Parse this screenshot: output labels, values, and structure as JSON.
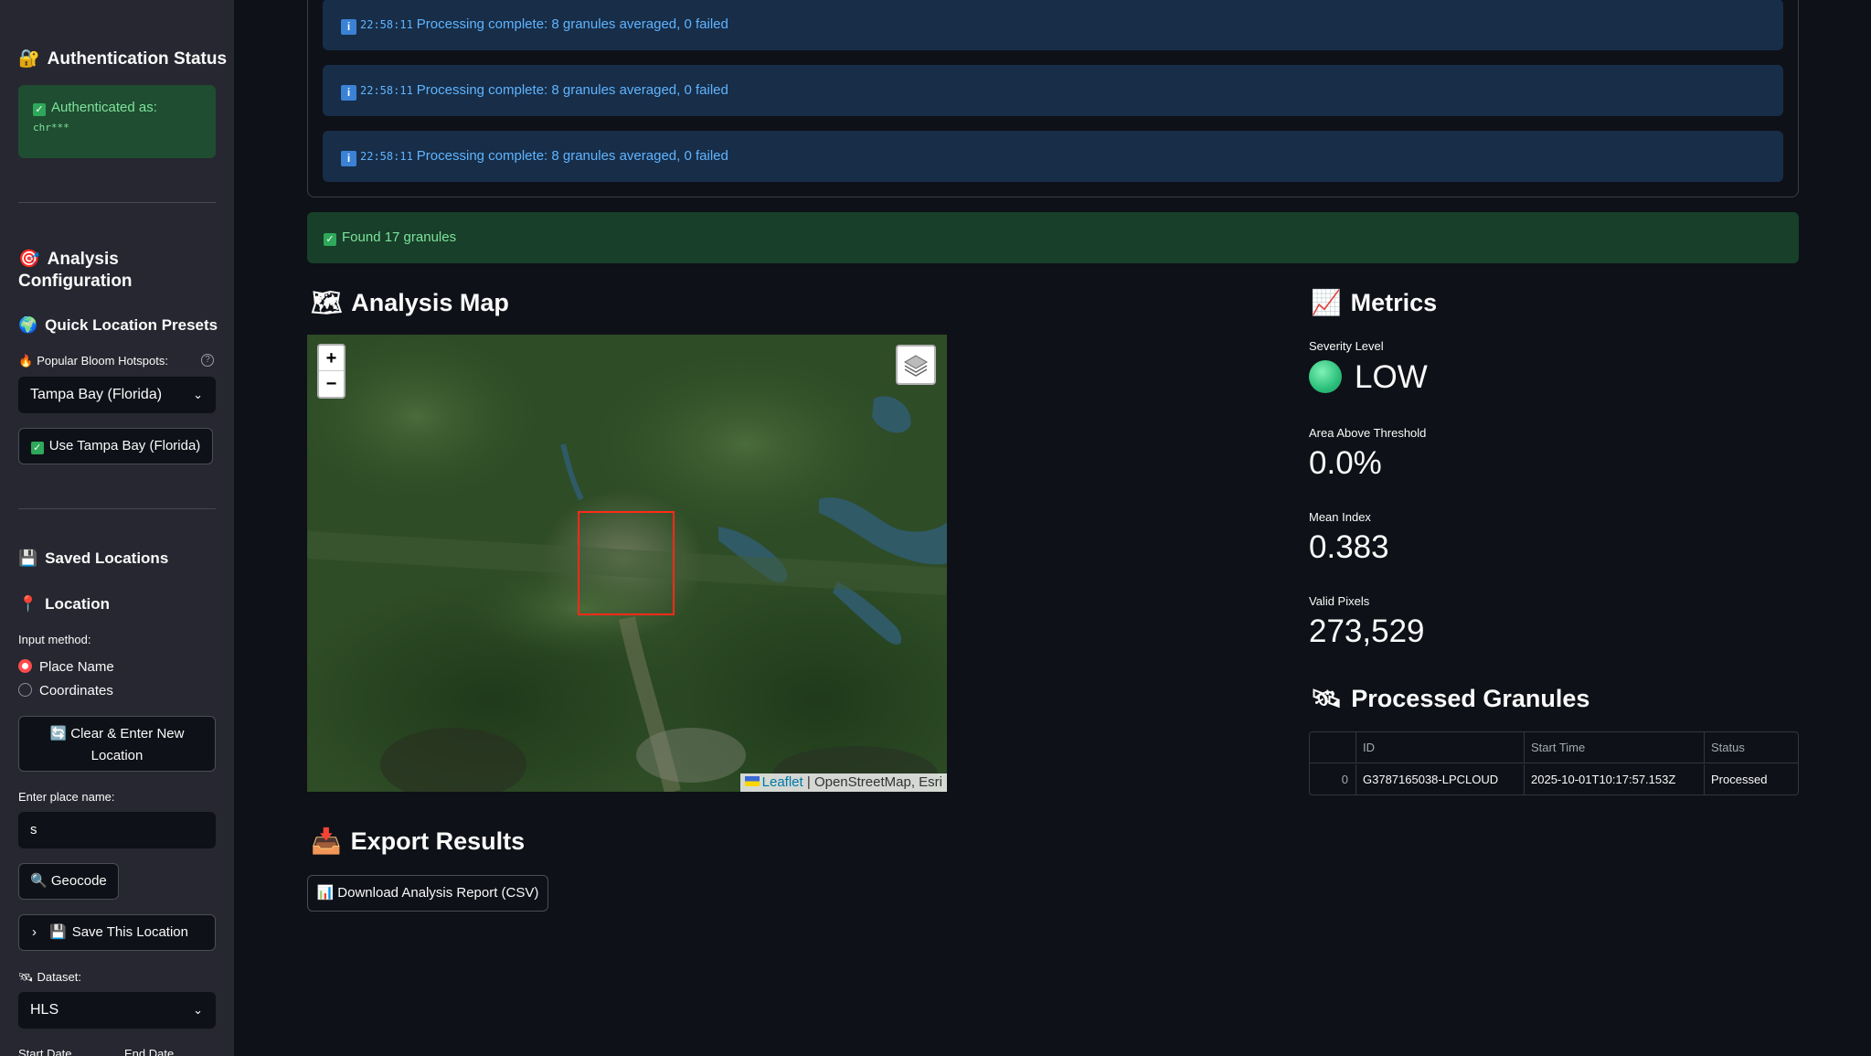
{
  "sidebar": {
    "auth_title": "Authentication Status",
    "auth_message": "Authenticated as:",
    "auth_user": "chr***",
    "analysis_title_1": "Analysis",
    "analysis_title_2": "Configuration",
    "presets_title": "Quick Location Presets",
    "hotspots_label": "Popular Bloom Hotspots:",
    "hotspot_selected": "Tampa Bay (Florida)",
    "use_preset_button": "Use Tampa Bay (Florida)",
    "saved_locations_title": "Saved Locations",
    "location_title": "Location",
    "input_method_label": "Input method:",
    "input_methods": [
      "Place Name",
      "Coordinates"
    ],
    "input_method_selected": "Place Name",
    "clear_button_1": "Clear & Enter New",
    "clear_button_2": "Location",
    "place_name_label": "Enter place name:",
    "place_name_value": "s",
    "geocode_button": "Geocode",
    "save_location_expander": "Save This Location",
    "dataset_label": "Dataset:",
    "dataset_selected": "HLS",
    "start_date_label": "Start Date",
    "end_date_label": "End Date"
  },
  "log": {
    "entries": [
      {
        "time": "22:58:11",
        "message": "Processing complete: 8 granules averaged, 0 failed"
      },
      {
        "time": "22:58:11",
        "message": "Processing complete: 8 granules averaged, 0 failed"
      },
      {
        "time": "22:58:11",
        "message": "Processing complete: 8 granules averaged, 0 failed"
      }
    ],
    "success_message": "Found 17 granules"
  },
  "map": {
    "title": "Analysis Map",
    "zoom_in": "+",
    "zoom_out": "−",
    "attribution_link": "Leaflet",
    "attribution_rest": "| OpenStreetMap, Esri"
  },
  "metrics": {
    "title": "Metrics",
    "severity_label": "Severity Level",
    "severity_value": "LOW",
    "severity_color": "#2bbf7a",
    "area_label": "Area Above Threshold",
    "area_value": "0.0%",
    "mean_label": "Mean Index",
    "mean_value": "0.383",
    "pixels_label": "Valid Pixels",
    "pixels_value": "273,529"
  },
  "granules": {
    "title": "Processed Granules",
    "columns": [
      "",
      "ID",
      "Start Time",
      "Status"
    ],
    "rows": [
      {
        "index": "0",
        "id": "G3787165038-LPCLOUD",
        "start_time": "2025-10-01T10:17:57.153Z",
        "status": "Processed"
      }
    ]
  },
  "export": {
    "title": "Export Results",
    "download_button": "Download Analysis Report (CSV)"
  }
}
